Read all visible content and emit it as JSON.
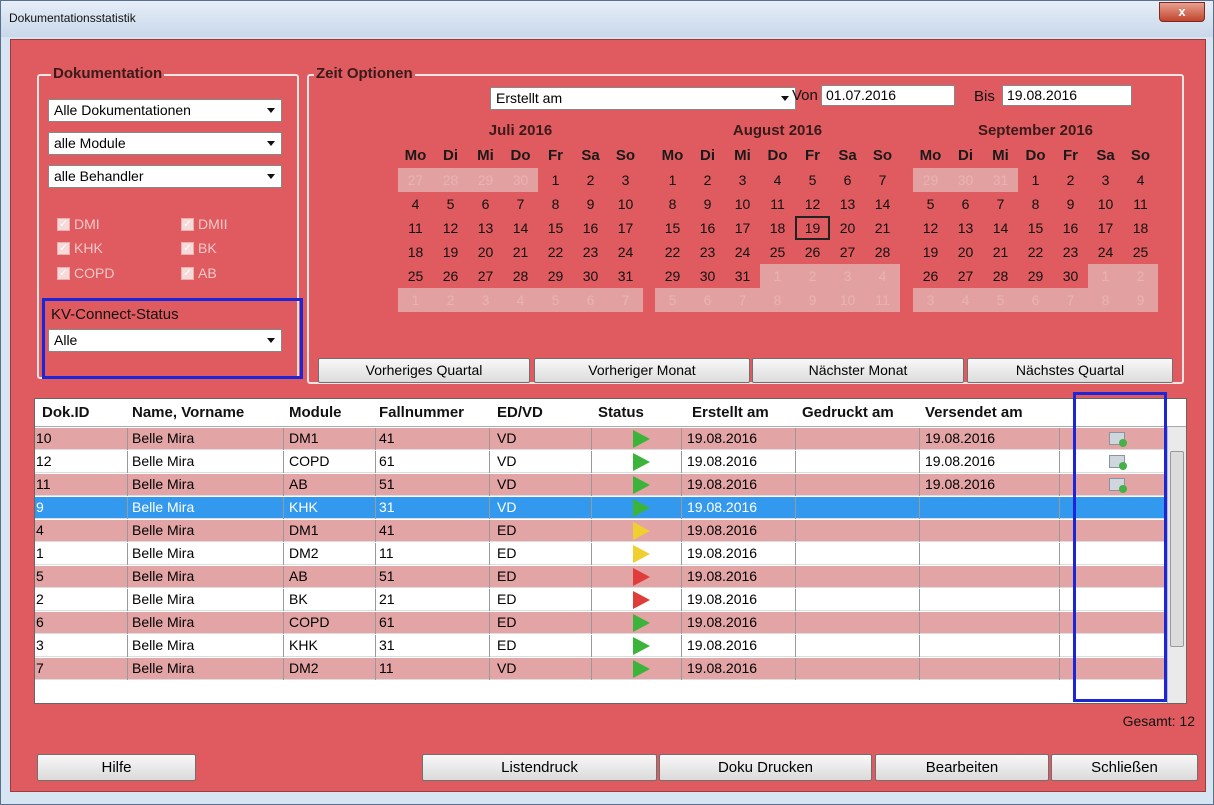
{
  "window": {
    "title": "Dokumentationsstatistik",
    "close": "x"
  },
  "doku": {
    "group": "Dokumentation",
    "combo1": "Alle Dokumentationen",
    "combo2": "alle Module",
    "combo3": "alle Behandler",
    "checks": [
      "DMI",
      "DMII",
      "KHK",
      "BK",
      "COPD",
      "AB"
    ],
    "kv_label": "KV-Connect-Status",
    "kv_value": "Alle"
  },
  "zeit": {
    "group": "Zeit Optionen",
    "mode": "Erstellt am",
    "von_label": "Von",
    "von": "01.07.2016",
    "bis_label": "Bis",
    "bis": "19.08.2016"
  },
  "weekdays": [
    "Mo",
    "Di",
    "Mi",
    "Do",
    "Fr",
    "Sa",
    "So"
  ],
  "months": [
    {
      "title": "Juli 2016",
      "days": [
        "27",
        "28",
        "29",
        "30",
        "1",
        "2",
        "3",
        "4",
        "5",
        "6",
        "7",
        "8",
        "9",
        "10",
        "11",
        "12",
        "13",
        "14",
        "15",
        "16",
        "17",
        "18",
        "19",
        "20",
        "21",
        "22",
        "23",
        "24",
        "25",
        "26",
        "27",
        "28",
        "29",
        "30",
        "31",
        "1",
        "2",
        "3",
        "4",
        "5",
        "6",
        "7"
      ],
      "other": [
        0,
        1,
        2,
        3,
        35,
        36,
        37,
        38,
        39,
        40,
        41
      ],
      "sel": -1
    },
    {
      "title": "August 2016",
      "days": [
        "1",
        "2",
        "3",
        "4",
        "5",
        "6",
        "7",
        "8",
        "9",
        "10",
        "11",
        "12",
        "13",
        "14",
        "15",
        "16",
        "17",
        "18",
        "19",
        "20",
        "21",
        "22",
        "23",
        "24",
        "25",
        "26",
        "27",
        "28",
        "29",
        "30",
        "31",
        "1",
        "2",
        "3",
        "4",
        "5",
        "6",
        "7",
        "8",
        "9",
        "10",
        "11"
      ],
      "other": [
        31,
        32,
        33,
        34,
        35,
        36,
        37,
        38,
        39,
        40,
        41
      ],
      "sel": 18
    },
    {
      "title": "September 2016",
      "days": [
        "29",
        "30",
        "31",
        "1",
        "2",
        "3",
        "4",
        "5",
        "6",
        "7",
        "8",
        "9",
        "10",
        "11",
        "12",
        "13",
        "14",
        "15",
        "16",
        "17",
        "18",
        "19",
        "20",
        "21",
        "22",
        "23",
        "24",
        "25",
        "26",
        "27",
        "28",
        "29",
        "30",
        "1",
        "2",
        "3",
        "4",
        "5",
        "6",
        "7",
        "8",
        "9"
      ],
      "other": [
        0,
        1,
        2,
        33,
        34,
        35,
        36,
        37,
        38,
        39,
        40,
        41
      ],
      "sel": -1
    }
  ],
  "nav": {
    "prev_q": "Vorheriges Quartal",
    "prev_m": "Vorheriger Monat",
    "next_m": "Nächster Monat",
    "next_q": "Nächstes Quartal"
  },
  "table": {
    "headers": [
      "Dok.ID",
      "Name, Vorname",
      "Module",
      "Fallnummer",
      "ED/VD",
      "Status",
      "Erstellt am",
      "Gedruckt am",
      "Versendet am"
    ],
    "rows": [
      {
        "id": "10",
        "name": "Belle Mira",
        "mod": "DM1",
        "fall": "41",
        "edvd": "VD",
        "status": "green",
        "erstellt": "19.08.2016",
        "gedruckt": "",
        "versendet": "19.08.2016",
        "icon": true
      },
      {
        "id": "12",
        "name": "Belle Mira",
        "mod": "COPD",
        "fall": "61",
        "edvd": "VD",
        "status": "green",
        "erstellt": "19.08.2016",
        "gedruckt": "",
        "versendet": "19.08.2016",
        "icon": true
      },
      {
        "id": "11",
        "name": "Belle Mira",
        "mod": "AB",
        "fall": "51",
        "edvd": "VD",
        "status": "green",
        "erstellt": "19.08.2016",
        "gedruckt": "",
        "versendet": "19.08.2016",
        "icon": true
      },
      {
        "id": "9",
        "name": "Belle Mira",
        "mod": "KHK",
        "fall": "31",
        "edvd": "VD",
        "status": "green",
        "erstellt": "19.08.2016",
        "gedruckt": "",
        "versendet": "",
        "icon": false
      },
      {
        "id": "4",
        "name": "Belle Mira",
        "mod": "DM1",
        "fall": "41",
        "edvd": "ED",
        "status": "yellow",
        "erstellt": "19.08.2016",
        "gedruckt": "",
        "versendet": "",
        "icon": false
      },
      {
        "id": "1",
        "name": "Belle Mira",
        "mod": "DM2",
        "fall": "11",
        "edvd": "ED",
        "status": "yellow",
        "erstellt": "19.08.2016",
        "gedruckt": "",
        "versendet": "",
        "icon": false
      },
      {
        "id": "5",
        "name": "Belle Mira",
        "mod": "AB",
        "fall": "51",
        "edvd": "ED",
        "status": "red",
        "erstellt": "19.08.2016",
        "gedruckt": "",
        "versendet": "",
        "icon": false
      },
      {
        "id": "2",
        "name": "Belle Mira",
        "mod": "BK",
        "fall": "21",
        "edvd": "ED",
        "status": "red",
        "erstellt": "19.08.2016",
        "gedruckt": "",
        "versendet": "",
        "icon": false
      },
      {
        "id": "6",
        "name": "Belle Mira",
        "mod": "COPD",
        "fall": "61",
        "edvd": "ED",
        "status": "green",
        "erstellt": "19.08.2016",
        "gedruckt": "",
        "versendet": "",
        "icon": false
      },
      {
        "id": "3",
        "name": "Belle Mira",
        "mod": "KHK",
        "fall": "31",
        "edvd": "ED",
        "status": "green",
        "erstellt": "19.08.2016",
        "gedruckt": "",
        "versendet": "",
        "icon": false
      },
      {
        "id": "7",
        "name": "Belle Mira",
        "mod": "DM2",
        "fall": "11",
        "edvd": "VD",
        "status": "green",
        "erstellt": "19.08.2016",
        "gedruckt": "",
        "versendet": "",
        "icon": false
      }
    ],
    "selected_index": 3,
    "total": "Gesamt: 12"
  },
  "buttons": {
    "hilfe": "Hilfe",
    "listendruck": "Listendruck",
    "doku_drucken": "Doku Drucken",
    "bearbeiten": "Bearbeiten",
    "schliessen": "Schließen"
  },
  "colors": {
    "background": "#e05b5f",
    "row_alt": "#e3a4a6",
    "selection": "#3399ee",
    "highlight": "#1b26d8"
  }
}
